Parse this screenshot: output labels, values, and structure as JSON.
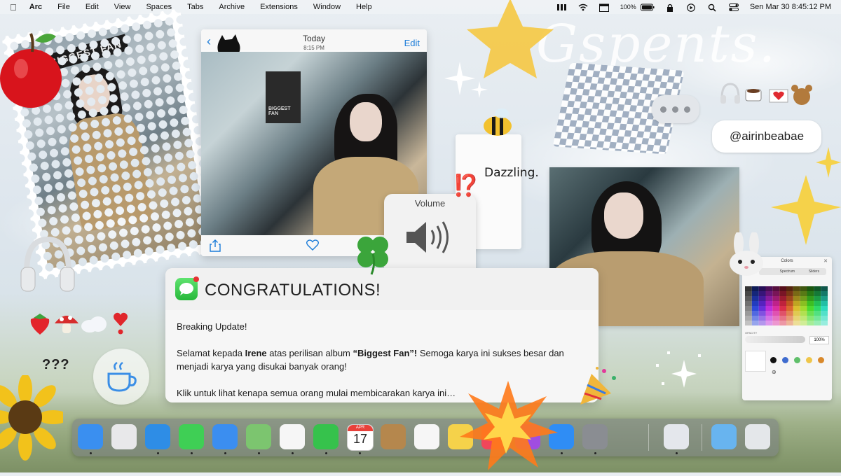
{
  "menubar": {
    "app_name": "Arc",
    "menus": [
      "File",
      "Edit",
      "View",
      "Spaces",
      "Tabs",
      "Archive",
      "Extensions",
      "Window",
      "Help"
    ],
    "battery": "100%",
    "clock": "Sen Mar 30  8:45:12 PM",
    "icons": [
      "apple-icon",
      "stage-manager-icon",
      "wifi-icon",
      "calendar-icon",
      "battery-icon",
      "lock-icon",
      "play-icon",
      "search-icon",
      "control-center-icon"
    ]
  },
  "stamp_photo": {
    "sign_text": "BIGGEST FAN"
  },
  "message_window": {
    "day": "Today",
    "time": "8:15 PM",
    "edit_label": "Edit",
    "poster_text": "BIGGEST FAN"
  },
  "dazzle_card": {
    "text": "Dazzling."
  },
  "volume_hud": {
    "label": "Volume",
    "level": 1.0
  },
  "notification": {
    "title": "CONGRATULATIONS!",
    "line1": "Breaking Update!",
    "line2_pre": "Selamat kepada ",
    "line2_name": "Irene",
    "line2_mid": " atas perilisan album ",
    "line2_album": "“Biggest Fan”!",
    "line2_post": " Semoga karya ini sukses besar dan menjadi karya yang disukai banyak orang!",
    "line3": "Klik untuk lihat kenapa semua orang mulai membicarakan karya ini…"
  },
  "handle_bubble": {
    "text": "@airinbeabae"
  },
  "script_text": "Gspents.",
  "question_marks": "???",
  "exclaim_question": "⁉️",
  "colors_panel": {
    "title": "Colors",
    "tabs": [
      "",
      "Spectrum",
      "Sliders"
    ],
    "opacity_label": "OPACITY",
    "opacity_value": "100%",
    "recent_colors": [
      "#111111",
      "#3f6ccf",
      "#5fbf6a",
      "#efc64a",
      "#d9892b"
    ]
  },
  "dock": {
    "apps": [
      {
        "name": "finder",
        "color": "#3a8ff0"
      },
      {
        "name": "launchpad",
        "color": "#e8e8ea"
      },
      {
        "name": "safari",
        "color": "#2e8de6"
      },
      {
        "name": "messages",
        "color": "#3fcf55"
      },
      {
        "name": "mail",
        "color": "#3b8ef0"
      },
      {
        "name": "maps",
        "color": "#7cc56f"
      },
      {
        "name": "photos",
        "color": "#f6f6f6"
      },
      {
        "name": "facetime",
        "color": "#36c24c"
      },
      {
        "name": "calendar",
        "color": "#ffffff"
      },
      {
        "name": "keynote-archive",
        "color": "#b5874d"
      },
      {
        "name": "reminders",
        "color": "#f6f6f6"
      },
      {
        "name": "notes",
        "color": "#f5d24a"
      },
      {
        "name": "music",
        "color": "#f0465a"
      },
      {
        "name": "podcasts",
        "color": "#a04de0"
      },
      {
        "name": "app-store",
        "color": "#2f8df5"
      },
      {
        "name": "system-settings",
        "color": "#8a8d92"
      },
      {
        "name": "preview",
        "color": "#e4e7ec"
      },
      {
        "name": "downloads-folder",
        "color": "#68b4ef"
      },
      {
        "name": "trash",
        "color": "#e4e7ea"
      }
    ],
    "calendar_month": "APR",
    "calendar_day": "17"
  }
}
